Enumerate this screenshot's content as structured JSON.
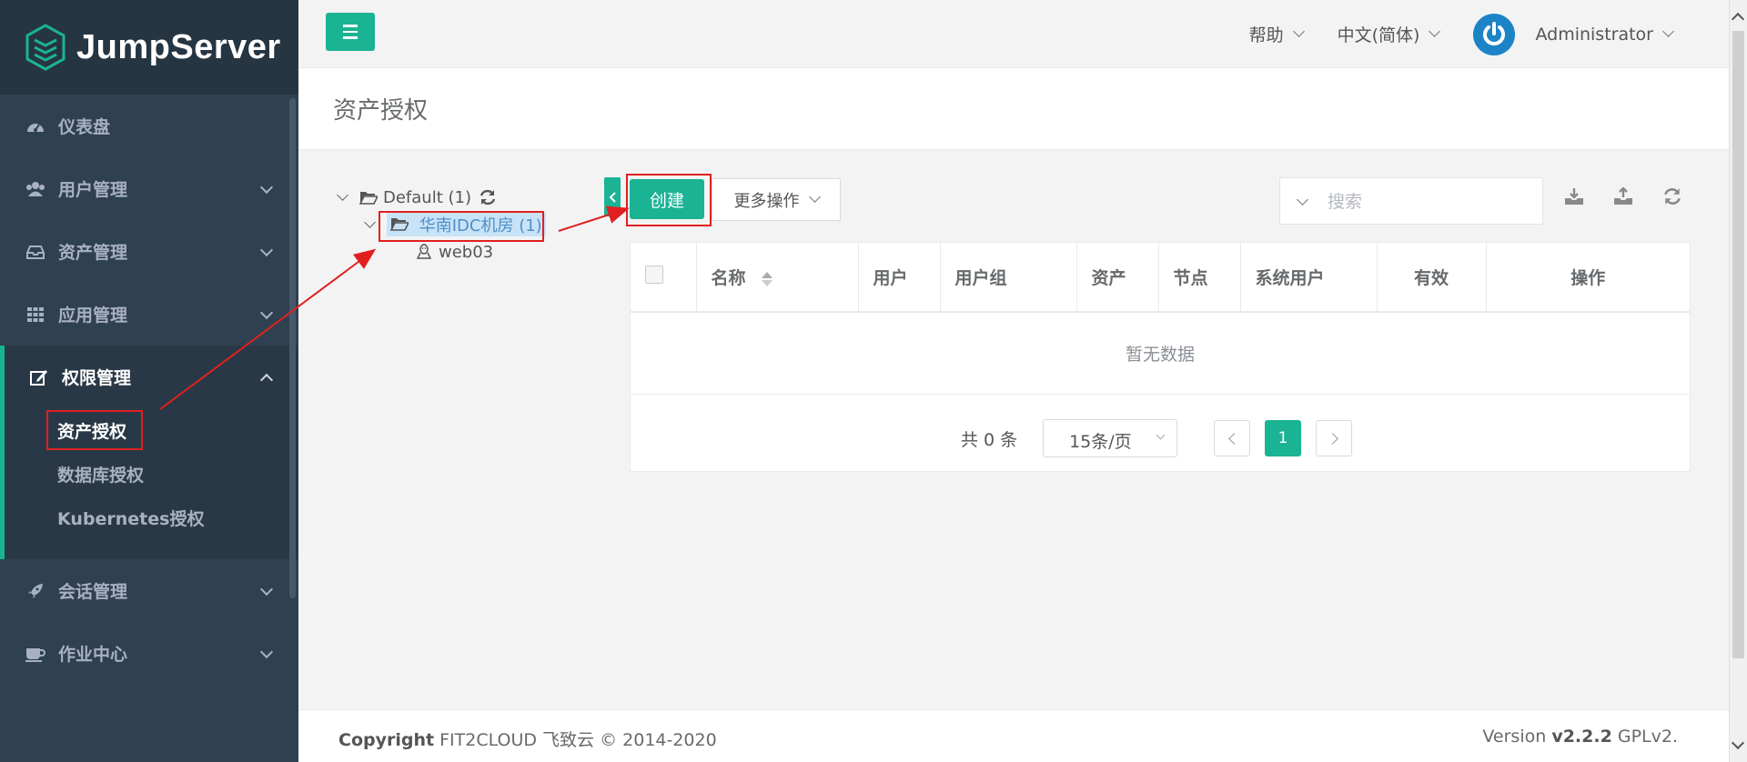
{
  "app": {
    "logo_text": "JumpServer"
  },
  "sidebar": {
    "items": [
      {
        "label": "仪表盘",
        "icon": "dashboard-icon"
      },
      {
        "label": "用户管理",
        "icon": "users-icon"
      },
      {
        "label": "资产管理",
        "icon": "inbox-icon"
      },
      {
        "label": "应用管理",
        "icon": "grid-icon"
      },
      {
        "label": "权限管理",
        "icon": "edit-icon"
      },
      {
        "label": "会话管理",
        "icon": "rocket-icon"
      },
      {
        "label": "作业中心",
        "icon": "coffee-icon"
      }
    ],
    "subitems": [
      {
        "label": "资产授权"
      },
      {
        "label": "数据库授权"
      },
      {
        "label": "Kubernetes授权"
      }
    ]
  },
  "topbar": {
    "help": "帮助",
    "language": "中文(简体)",
    "user": "Administrator"
  },
  "page": {
    "title": "资产授权"
  },
  "tree": {
    "root": "Default (1)",
    "node": "华南IDC机房 (1)",
    "leaf": "web03"
  },
  "toolbar": {
    "create": "创建",
    "more": "更多操作",
    "search_placeholder": "搜索"
  },
  "table": {
    "columns": [
      "名称",
      "用户",
      "用户组",
      "资产",
      "节点",
      "系统用户",
      "有效",
      "操作"
    ],
    "empty_text": "暂无数据"
  },
  "pagination": {
    "total": "共 0 条",
    "page_size": "15条/页",
    "current_page": "1"
  },
  "footer": {
    "copyright_label": "Copyright",
    "copyright_text": "FIT2CLOUD 飞致云 © 2014-2020",
    "version_label": "Version",
    "version_number": "v2.2.2",
    "license": "GPLv2."
  },
  "colors": {
    "accent": "#1ab394",
    "sidebar": "#2f4050",
    "annotation": "#e02020"
  }
}
